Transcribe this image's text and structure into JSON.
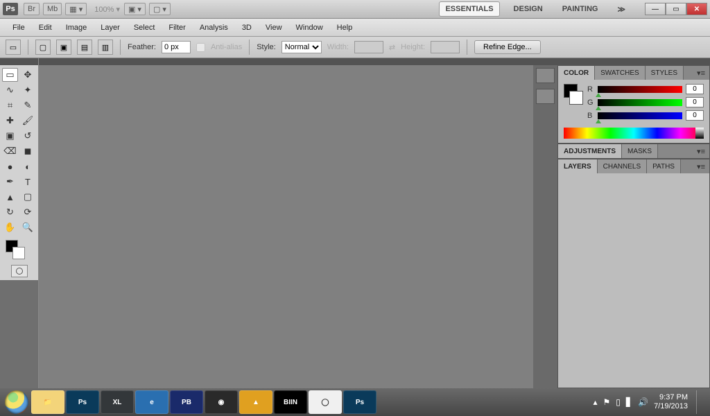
{
  "appbar": {
    "logo": "Ps",
    "chips": [
      "Br",
      "Mb"
    ],
    "zoom": "100%",
    "workspaces": [
      "ESSENTIALS",
      "DESIGN",
      "PAINTING"
    ],
    "active_workspace": 0
  },
  "menubar": [
    "File",
    "Edit",
    "Image",
    "Layer",
    "Select",
    "Filter",
    "Analysis",
    "3D",
    "View",
    "Window",
    "Help"
  ],
  "optbar": {
    "feather_label": "Feather:",
    "feather_value": "0 px",
    "antialias_label": "Anti-alias",
    "style_label": "Style:",
    "style_value": "Normal",
    "width_label": "Width:",
    "height_label": "Height:",
    "refine_edge": "Refine Edge..."
  },
  "tools": [
    "marquee",
    "move",
    "lasso",
    "quick-select",
    "crop",
    "eyedropper",
    "heal",
    "brush",
    "stamp",
    "history-brush",
    "eraser",
    "gradient",
    "blur",
    "dodge",
    "pen",
    "type",
    "path-select",
    "shape",
    "3d-rotate",
    "3d-orbit",
    "hand",
    "zoom"
  ],
  "tool_glyphs": [
    "▭",
    "✥",
    "∿",
    "✦",
    "⌗",
    "✎",
    "✚",
    "🖌",
    "▣",
    "↺",
    "⌫",
    "◼",
    "●",
    "◐",
    "✒",
    "T",
    "▲",
    "▢",
    "↻",
    "⟳",
    "✋",
    "🔍"
  ],
  "selected_tool": 0,
  "panels": {
    "color": {
      "tabs": [
        "COLOR",
        "SWATCHES",
        "STYLES"
      ],
      "active": 0,
      "r": "0",
      "g": "0",
      "b": "0",
      "r_label": "R",
      "g_label": "G",
      "b_label": "B"
    },
    "adjustments": {
      "tabs": [
        "ADJUSTMENTS",
        "MASKS"
      ],
      "active": 0
    },
    "layers": {
      "tabs": [
        "LAYERS",
        "CHANNELS",
        "PATHS"
      ],
      "active": 0
    }
  },
  "taskbar": {
    "apps": [
      {
        "name": "explorer",
        "label": "📁",
        "bg": "#f3d47a"
      },
      {
        "name": "photoshop",
        "label": "Ps",
        "bg": "#0a3a5a"
      },
      {
        "name": "xl",
        "label": "XL",
        "bg": "#33373a"
      },
      {
        "name": "ie",
        "label": "e",
        "bg": "#2a6fb0"
      },
      {
        "name": "app-pb",
        "label": "PB",
        "bg": "#1a2a6a"
      },
      {
        "name": "media",
        "label": "◉",
        "bg": "#2a2a2a"
      },
      {
        "name": "aimp",
        "label": "▲",
        "bg": "#e0a020"
      },
      {
        "name": "biin",
        "label": "BIIN",
        "bg": "#000"
      },
      {
        "name": "chrome",
        "label": "◯",
        "bg": "#f0f0f0"
      },
      {
        "name": "photoshop-2",
        "label": "Ps",
        "bg": "#0a3a5a"
      }
    ],
    "time": "9:37 PM",
    "date": "7/19/2013"
  }
}
